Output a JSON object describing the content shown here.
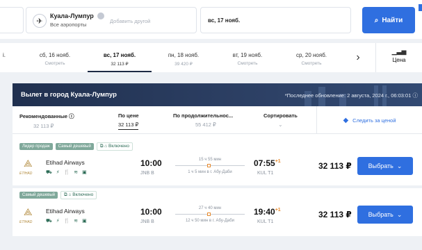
{
  "search": {
    "destination_name": "Куала-Лумпур",
    "destination_sub": "Все аэропорты",
    "add_another": "Добавить другой",
    "date": "вс, 17 нояб.",
    "find_button": "Найти"
  },
  "dates": [
    {
      "day": "сб, 16 нояб.",
      "price": "Смотреть"
    },
    {
      "day": "вс, 17 нояб.",
      "price": "32 113 ₽"
    },
    {
      "day": "пн, 18 нояб.",
      "price": "39 420 ₽"
    },
    {
      "day": "вт, 19 нояб.",
      "price": "Смотреть"
    },
    {
      "day": "ср, 20 нояб.",
      "price": "Смотреть"
    }
  ],
  "dates_leftover": "i.",
  "price_toggle": {
    "icon": "bar-chart-icon",
    "label": "Цена"
  },
  "results": {
    "title": "Вылет в город Куала-Лумпур",
    "updated": "*Последнее обновление: 2 августа, 2024 г., 06:03:01 ⓘ",
    "sort": [
      {
        "label": "Рекомендованные ⓘ",
        "value": "32 113 ₽"
      },
      {
        "label": "По цене",
        "value": "32 113 ₽"
      },
      {
        "label": "По продолжительнос...",
        "value": "55 412 ₽"
      },
      {
        "label": "Сортировать",
        "value": "⌄"
      }
    ],
    "track_price": "Следить за ценой"
  },
  "flights": [
    {
      "badges": [
        "Лидер продаж",
        "Самый дешевый"
      ],
      "included": "Включено",
      "airline": "Etihad Airways",
      "logo_text": "ETIHAD",
      "amenities": "⛟ ⚡ 🍴 ≋ ▣",
      "dep_time": "10:00",
      "dep_airport": "JNB B",
      "duration": "15 ч 55 мин",
      "stop": "1 ч 5 мин в г. Абу-Даби",
      "arr_time": "07:55",
      "arr_plus": "+1",
      "arr_airport": "KUL T1",
      "price": "32 113 ₽",
      "choose": "Выбрать"
    },
    {
      "badges": [
        "Самый дешевый"
      ],
      "included": "Включено",
      "airline": "Etihad Airways",
      "logo_text": "ETIHAD",
      "amenities": "⛟ ⚡ 🍴 ≋ ▣",
      "dep_time": "10:00",
      "dep_airport": "JNB B",
      "duration": "27 ч 40 мин",
      "stop": "12 ч 50 мин в г. Абу-Даби",
      "arr_time": "19:40",
      "arr_plus": "+1",
      "arr_airport": "KUL T1",
      "price": "32 113 ₽",
      "choose": "Выбрать"
    }
  ],
  "colors": {
    "accent": "#2f6fe0",
    "banner": "#20304f",
    "badge": "#7fa89a",
    "stopover": "#e68a2e"
  }
}
